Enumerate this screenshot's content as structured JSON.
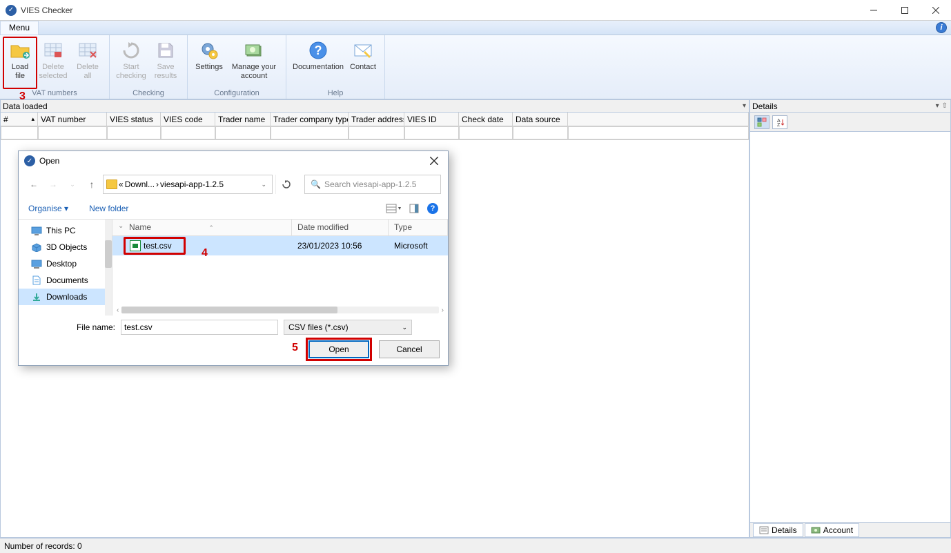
{
  "app": {
    "title": "VIES Checker"
  },
  "menu": {
    "tab": "Menu"
  },
  "ribbon": {
    "groups": [
      {
        "label": "VAT numbers",
        "buttons": [
          {
            "key": "load",
            "line1": "Load",
            "line2": "file",
            "disabled": false,
            "highlighted": true
          },
          {
            "key": "delsel",
            "line1": "Delete",
            "line2": "selected",
            "disabled": true
          },
          {
            "key": "delall",
            "line1": "Delete",
            "line2": "all",
            "disabled": true
          }
        ]
      },
      {
        "label": "Checking",
        "buttons": [
          {
            "key": "start",
            "line1": "Start",
            "line2": "checking",
            "disabled": true
          },
          {
            "key": "save",
            "line1": "Save",
            "line2": "results",
            "disabled": true
          }
        ]
      },
      {
        "label": "Configuration",
        "buttons": [
          {
            "key": "settings",
            "line1": "Settings",
            "line2": "",
            "disabled": false
          },
          {
            "key": "account",
            "line1": "Manage your",
            "line2": "account",
            "disabled": false,
            "wide": true
          }
        ]
      },
      {
        "label": "Help",
        "buttons": [
          {
            "key": "docs",
            "line1": "Documentation",
            "line2": "",
            "disabled": false,
            "wide": true
          },
          {
            "key": "contact",
            "line1": "Contact",
            "line2": "",
            "disabled": false
          }
        ]
      }
    ]
  },
  "dataPanel": {
    "tab": "Data loaded",
    "columns": [
      "#",
      "VAT number",
      "VIES status",
      "VIES code",
      "Trader name",
      "Trader company type",
      "Trader address",
      "VIES ID",
      "Check date",
      "Data source"
    ]
  },
  "detailsPanel": {
    "title": "Details",
    "tabs": [
      "Details",
      "Account"
    ]
  },
  "statusbar": {
    "text": "Number of records: 0"
  },
  "fileDialog": {
    "title": "Open",
    "breadcrumb": {
      "prefix": "«",
      "part1": "Downl...",
      "sep": "›",
      "part2": "viesapi-app-1.2.5"
    },
    "searchPlaceholder": "Search viesapi-app-1.2.5",
    "toolbar": {
      "organise": "Organise ▾",
      "newFolder": "New folder"
    },
    "tree": [
      "This PC",
      "3D Objects",
      "Desktop",
      "Documents",
      "Downloads"
    ],
    "treeSelected": 4,
    "fileHeader": {
      "name": "Name",
      "date": "Date modified",
      "type": "Type"
    },
    "file": {
      "name": "test.csv",
      "date": "23/01/2023 10:56",
      "type": "Microsoft"
    },
    "fileNameLabel": "File name:",
    "fileNameValue": "test.csv",
    "fileTypeValue": "CSV files (*.csv)",
    "openBtn": "Open",
    "cancelBtn": "Cancel"
  },
  "annotations": {
    "three": "3",
    "four": "4",
    "five": "5"
  }
}
